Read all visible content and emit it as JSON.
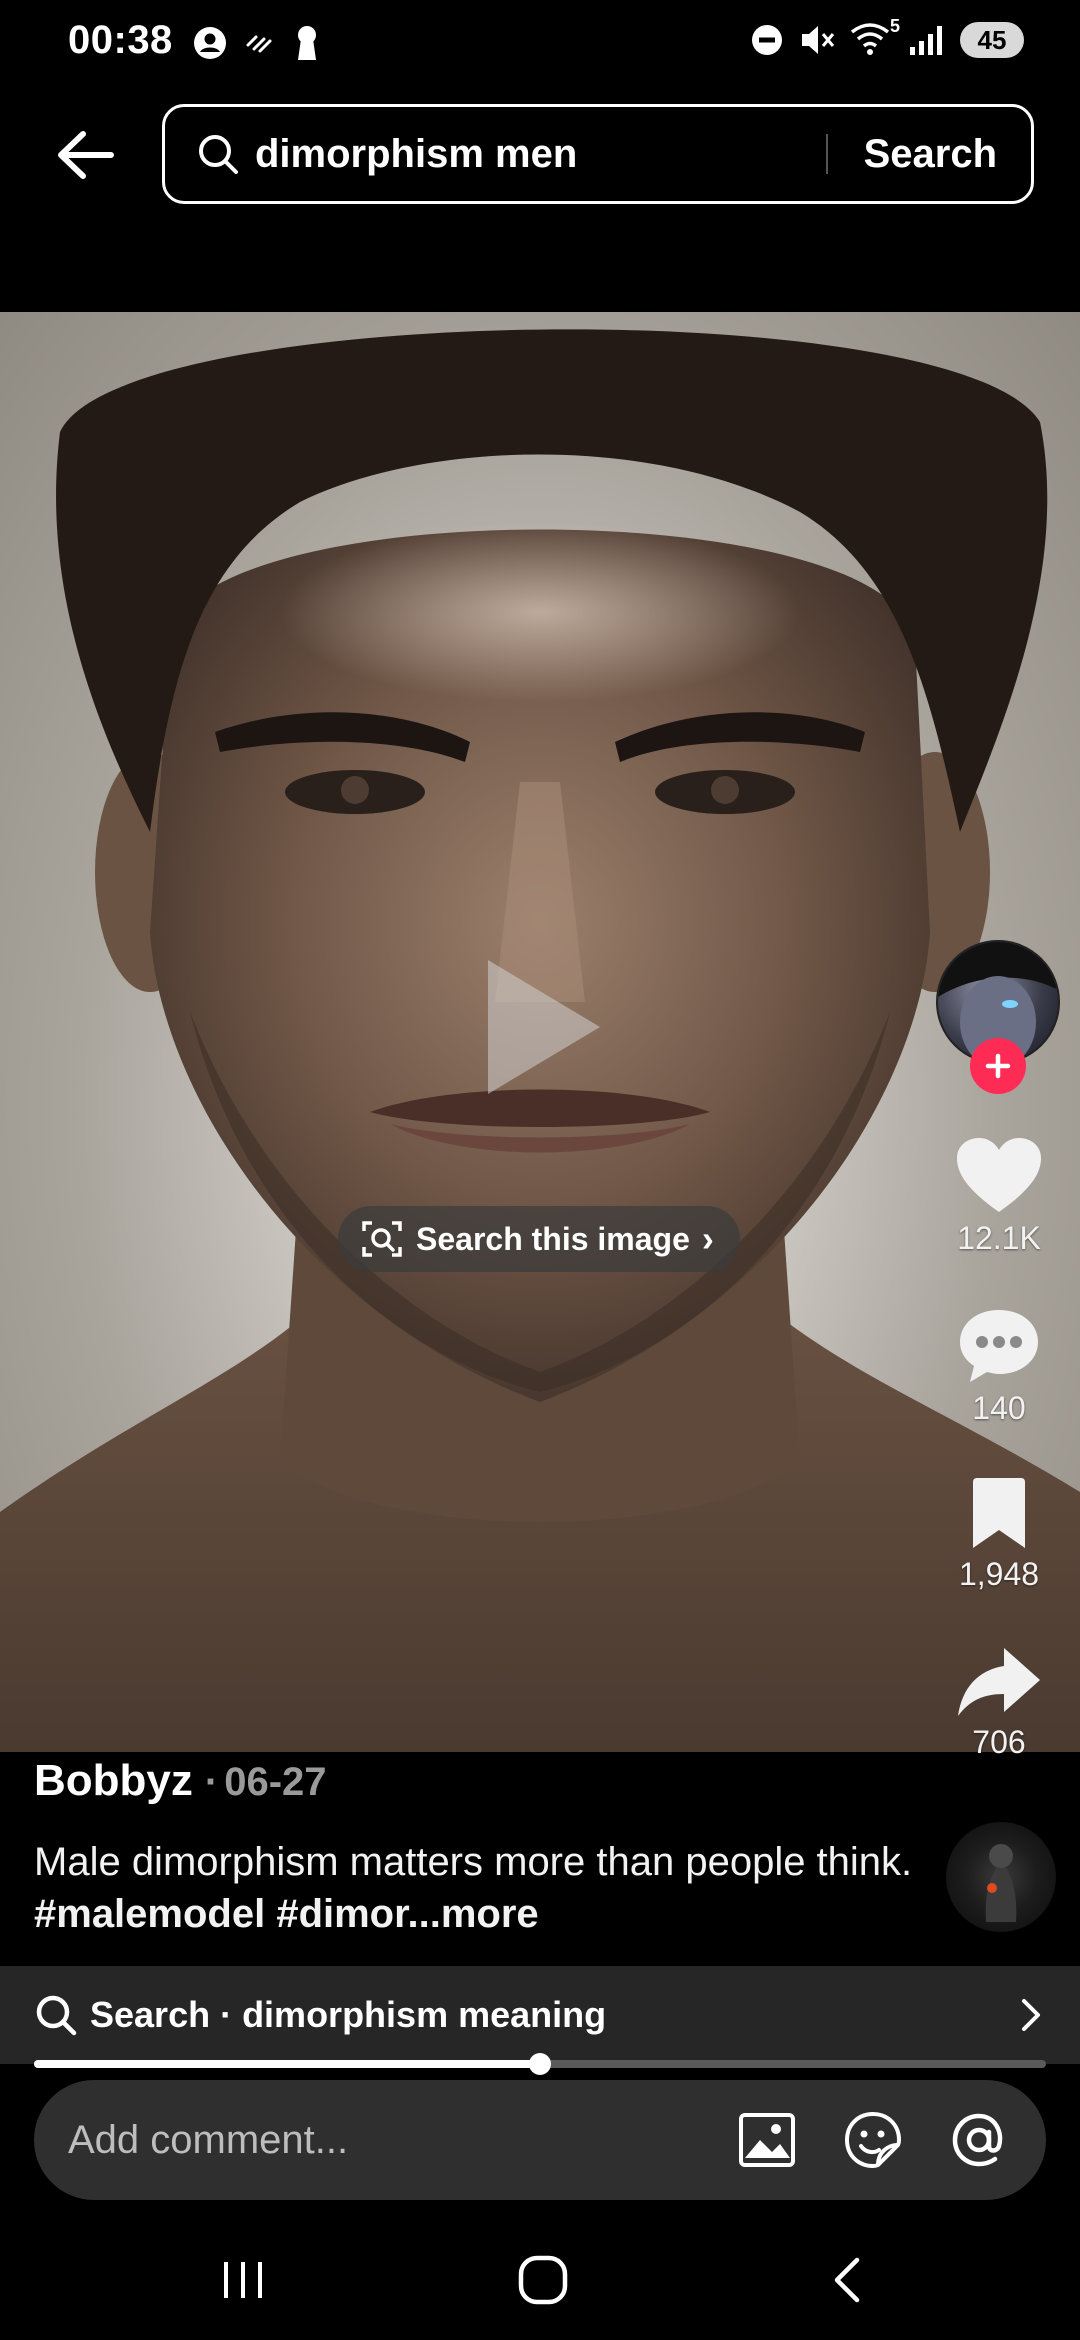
{
  "status_bar": {
    "time": "00:38",
    "left_icons": [
      "account-circle-icon",
      "wind-icon",
      "keyhole-icon"
    ],
    "right_icons": [
      "do-not-disturb-icon",
      "mute-icon",
      "wifi-icon",
      "signal-icon"
    ],
    "wifi_label": "5",
    "battery": "45"
  },
  "search": {
    "query": "dimorphism men",
    "submit_label": "Search"
  },
  "video": {
    "search_image_label": "Search this image",
    "chip_chevron": "›"
  },
  "actions": {
    "likes": "12.1K",
    "comments": "140",
    "saves": "1,948",
    "shares": "706"
  },
  "post": {
    "author": "Bobbyz",
    "date_separator": "·",
    "date": "06-27",
    "caption_text": "Male dimorphism matters more than people think. ",
    "caption_tags": "#malemodel #dimor",
    "caption_more": "...more"
  },
  "related_search": {
    "label": "Search · dimorphism meaning"
  },
  "playback": {
    "progress_fraction": 0.5
  },
  "comment_bar": {
    "placeholder": "Add comment..."
  },
  "colors": {
    "accent_follow": "#fe2c55",
    "background": "#000000",
    "bar": "#262626"
  }
}
